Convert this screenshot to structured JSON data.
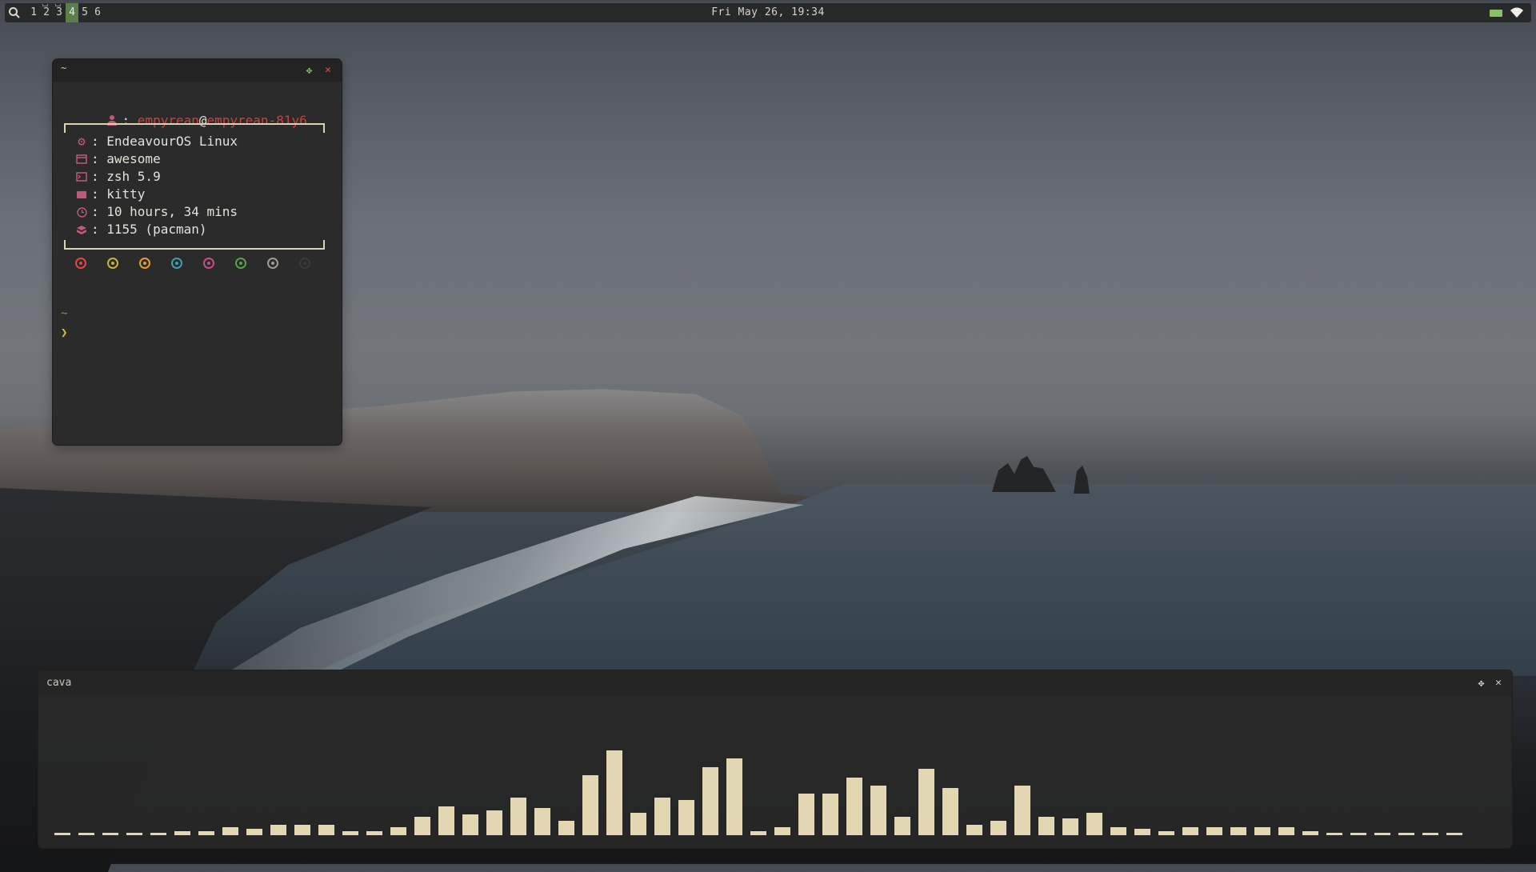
{
  "topbar": {
    "tags": [
      "1",
      "2",
      "3",
      "4",
      "5",
      "6"
    ],
    "active_tag": "4",
    "occupied_tags": [
      "2",
      "3"
    ],
    "clock": "Fri May 26, 19:34",
    "icons": [
      "search-icon",
      "battery-icon",
      "wifi-icon"
    ],
    "battery_color": "#8bbf6a",
    "active_tag_color": "#5b7f4c"
  },
  "terminal": {
    "title": "~",
    "user": "empyrean",
    "at": "@",
    "host": "empyrean-81y6",
    "sep": ": ",
    "info": [
      {
        "icon": "gear-icon",
        "value": "EndeavourOS Linux"
      },
      {
        "icon": "window-icon",
        "value": "awesome"
      },
      {
        "icon": "terminal-icon",
        "value": "zsh 5.9"
      },
      {
        "icon": "cat-icon",
        "value": "kitty"
      },
      {
        "icon": "clock-icon",
        "value": "10 hours, 34 mins"
      },
      {
        "icon": "package-icon",
        "value": "1155 (pacman)"
      }
    ],
    "palette": [
      "#e04848",
      "#c7b43a",
      "#e0a030",
      "#3f9fb0",
      "#c0508a",
      "#5aa04a",
      "#a09a90",
      "#3a3a3a"
    ],
    "prompt_dir": "~",
    "prompt_symbol": "❯"
  },
  "cava": {
    "title": "cava",
    "bar_levels": [
      1,
      1,
      1,
      1,
      1,
      2,
      2,
      4,
      3,
      5,
      5,
      5,
      2,
      2,
      4,
      9,
      14,
      10,
      12,
      18,
      13,
      7,
      29,
      41,
      11,
      18,
      17,
      33,
      37,
      2,
      4,
      20,
      20,
      28,
      24,
      9,
      32,
      23,
      5,
      7,
      24,
      9,
      8,
      11,
      4,
      3,
      2,
      4,
      4,
      4,
      4,
      4,
      2,
      1,
      1,
      1,
      1,
      1,
      1
    ],
    "bar_max": 41,
    "bar_color": "#e3d6b2"
  }
}
